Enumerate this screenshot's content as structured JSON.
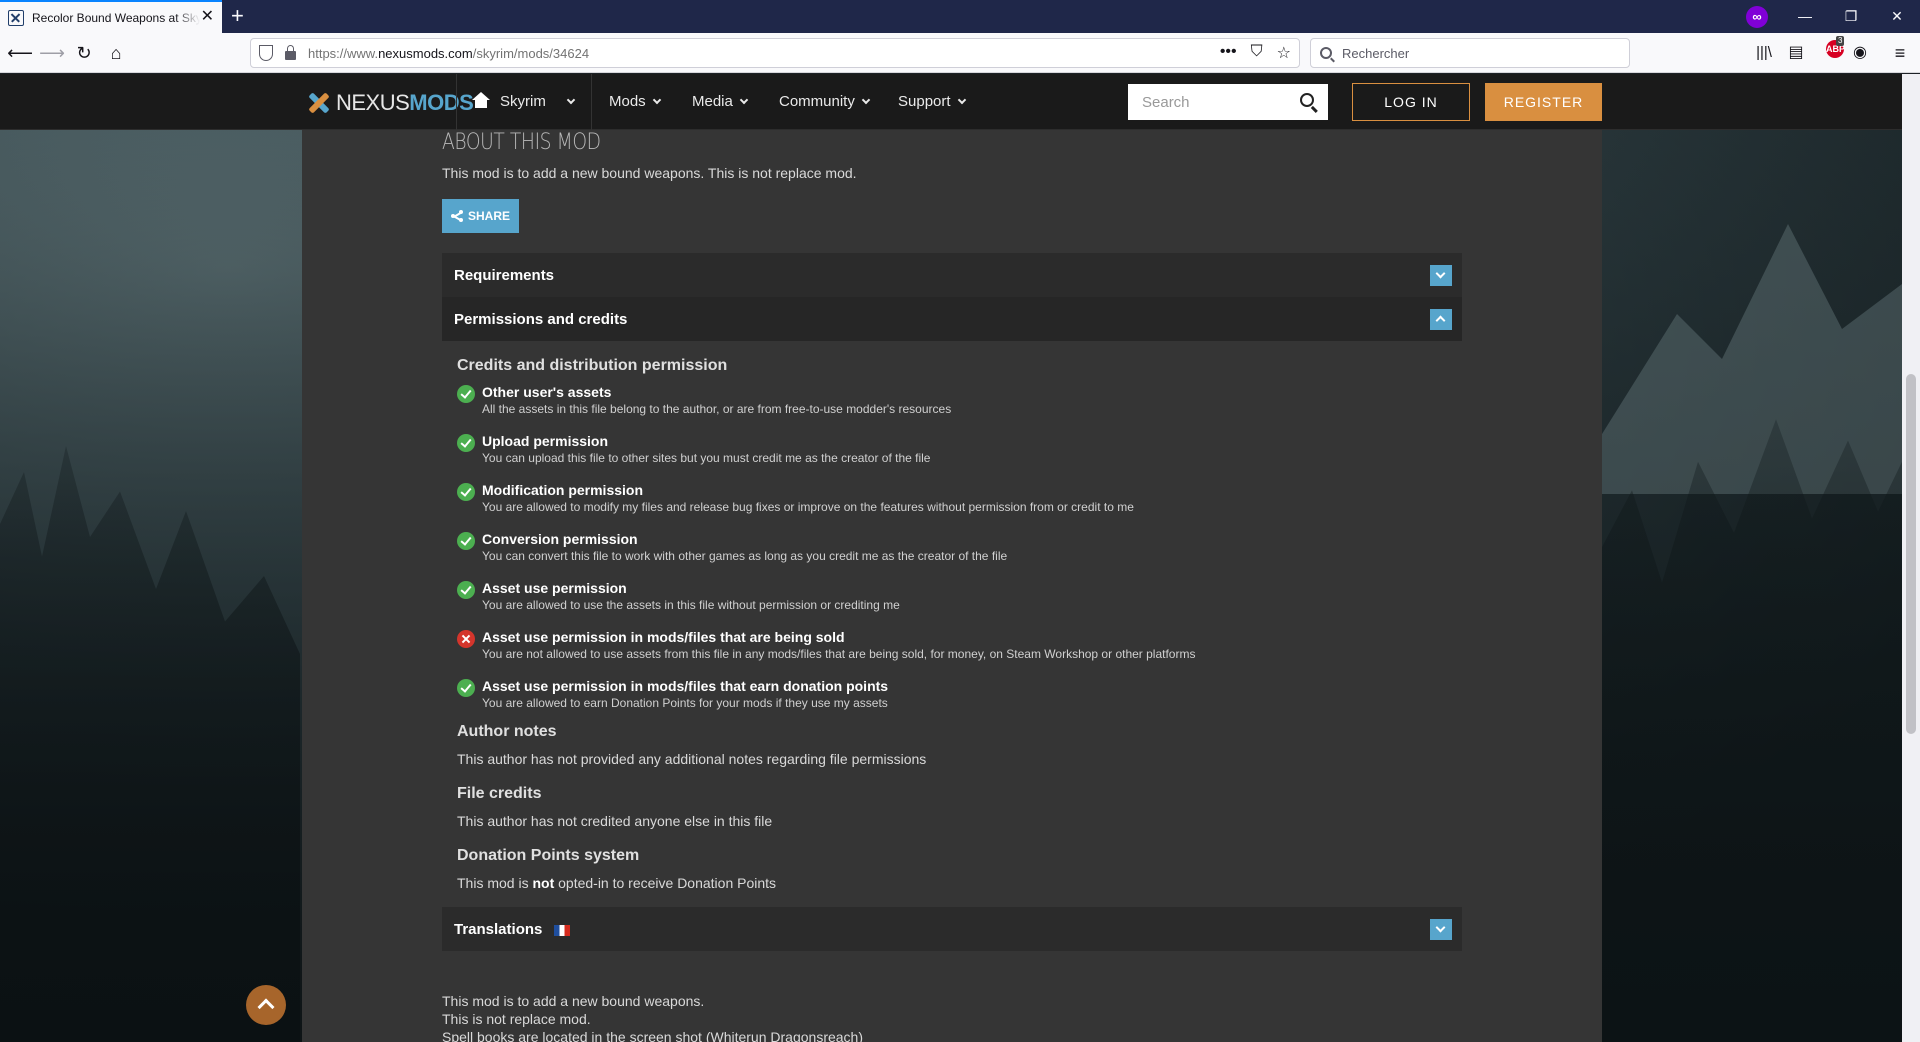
{
  "browser": {
    "tab_title": "Recolor Bound Weapons at Skyrim Nexus",
    "tab_close": "✕",
    "new_tab": "+",
    "url_prefix": "https://www.",
    "url_domain": "nexusmods.com",
    "url_path": "/skyrim/mods/34624",
    "search_placeholder": "Rechercher",
    "addon_badge_count": "3",
    "addon_badge_label": "ABP"
  },
  "site": {
    "logo_part1": "NEXUS",
    "logo_part2": "MODS",
    "nav": {
      "game": "Skyrim",
      "mods": "Mods",
      "media": "Media",
      "community": "Community",
      "support": "Support"
    },
    "search_placeholder": "Search",
    "login_label": "LOG IN",
    "register_label": "REGISTER"
  },
  "mod": {
    "about_title": "ABOUT THIS MOD",
    "about_desc": "This mod is to add a new bound weapons. This is not replace mod.",
    "share_label": "SHARE",
    "sections": {
      "requirements": "Requirements",
      "permissions": "Permissions and credits",
      "translations": "Translations"
    },
    "credits_title": "Credits and distribution permission",
    "permissions": [
      {
        "title": "Other user's assets",
        "desc": "All the assets in this file belong to the author, or are from free-to-use modder's resources",
        "allowed": true
      },
      {
        "title": "Upload permission",
        "desc": "You can upload this file to other sites but you must credit me as the creator of the file",
        "allowed": true
      },
      {
        "title": "Modification permission",
        "desc": "You are allowed to modify my files and release bug fixes or improve on the features without permission from or credit to me",
        "allowed": true
      },
      {
        "title": "Conversion permission",
        "desc": "You can convert this file to work with other games as long as you credit me as the creator of the file",
        "allowed": true
      },
      {
        "title": "Asset use permission",
        "desc": "You are allowed to use the assets in this file without permission or crediting me",
        "allowed": true
      },
      {
        "title": "Asset use permission in mods/files that are being sold",
        "desc": "You are not allowed to use assets from this file in any mods/files that are being sold, for money, on Steam Workshop or other platforms",
        "allowed": false
      },
      {
        "title": "Asset use permission in mods/files that earn donation points",
        "desc": "You are allowed to earn Donation Points for your mods if they use my assets",
        "allowed": true
      }
    ],
    "author_notes_title": "Author notes",
    "author_notes_text": "This author has not provided any additional notes regarding file permissions",
    "file_credits_title": "File credits",
    "file_credits_text": "This author has not credited anyone else in this file",
    "donation_title": "Donation Points system",
    "donation_text_1": "This mod is ",
    "donation_text_bold": "not",
    "donation_text_2": " opted-in to receive Donation Points",
    "description_lines": [
      "This mod is to add a new bound weapons.",
      "This is not replace mod.",
      "Spell books are located in the screen shot (Whiterun Dragonsreach)"
    ]
  },
  "colors": {
    "accent_blue": "#57a5cc",
    "accent_orange": "#d98f40",
    "allowed_green": "#4caf50",
    "denied_red": "#d4352c"
  }
}
